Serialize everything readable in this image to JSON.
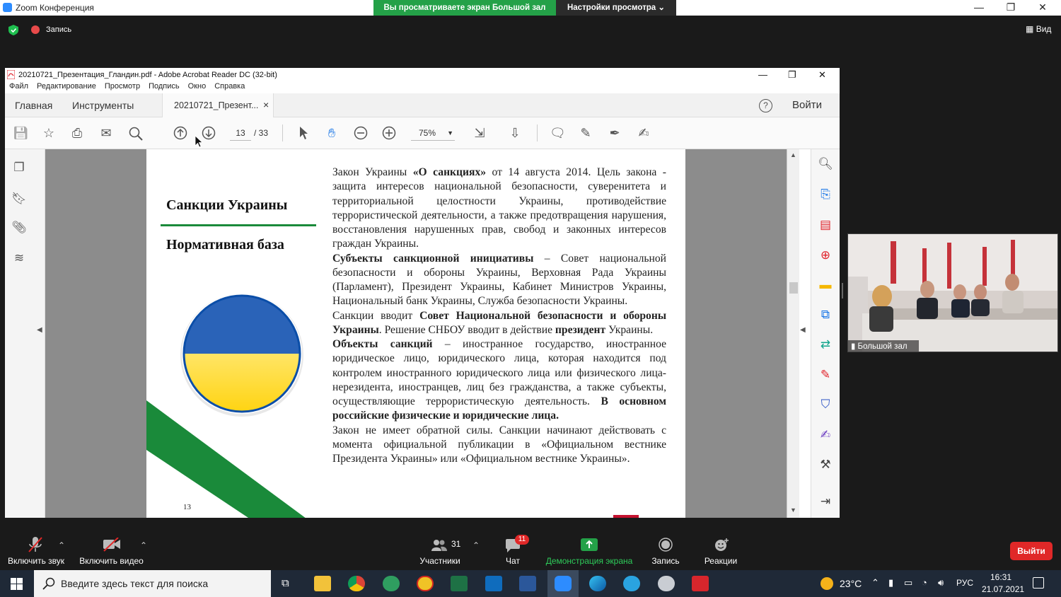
{
  "zoom": {
    "window_title": "Zoom Конференция",
    "share_banner": "Вы просматриваете экран Большой зал",
    "view_settings": "Настройки просмотра",
    "view_settings_caret": "⌄",
    "recording_label": "Запись",
    "view_label": "Вид",
    "minimize_glyph": "—",
    "maximize_glyph": "❐",
    "close_glyph": "✕"
  },
  "acrobat": {
    "title": "20210721_Презентация_Гландин.pdf - Adobe Acrobat Reader DC (32-bit)",
    "menu": [
      "Файл",
      "Редактирование",
      "Просмотр",
      "Подпись",
      "Окно",
      "Справка"
    ],
    "tabs": {
      "home": "Главная",
      "tools": "Инструменты",
      "doc": "20210721_Презент...",
      "close": "×"
    },
    "help": "?",
    "login": "Войти",
    "page_current": "13",
    "page_total": "/ 33",
    "zoom_level": "75%"
  },
  "slide": {
    "heading1": "Санкции Украины",
    "heading2": "Нормативная база",
    "page_number": "13",
    "paragraphs": [
      [
        {
          "t": "Закон Украины ",
          "b": false
        },
        {
          "t": "«О санкциях»",
          "b": true
        },
        {
          "t": " от 14 августа 2014. Цель закона - защита интересов национальной безопасности, суверенитета и территориальной целостности Украины, противодействие террористической деятельности, а также предотвращения нарушения, восстановления нарушенных прав, свобод и законных интересов граждан Украины.",
          "b": false
        }
      ],
      [
        {
          "t": "Субъекты санкционной инициативы",
          "b": true
        },
        {
          "t": " – Совет национальной безопасности и обороны Украины, Верховная Рада Украины (Парламент), Президент Украины, Кабинет Министров Украины, Национальный банк Украины, Служба безопасности Украины.",
          "b": false
        }
      ],
      [
        {
          "t": "Санкции вводит ",
          "b": false
        },
        {
          "t": "Совет Национальной безопасности и обороны Украины",
          "b": true
        },
        {
          "t": ". Решение СНБОУ вводит в действие ",
          "b": false
        },
        {
          "t": "президент",
          "b": true
        },
        {
          "t": " Украины.",
          "b": false
        }
      ],
      [
        {
          "t": "Объекты санкций",
          "b": true
        },
        {
          "t": " – иностранное государство, иностранное юридическое лицо, юридического лица, которая находится под контролем иностранного юридического лица или физического лица-нерезидента, иностранцев, лиц без гражданства, а также субъекты, осуществляющие террористическую деятельность. ",
          "b": false
        },
        {
          "t": "В основном российские физические и юридические лица.",
          "b": true
        }
      ],
      [
        {
          "t": "Закон не имеет обратной силы. Санкции начинают действовать с момента официальной публикации в «Официальном вестнике Президента Украины» или «Официальном вестнике Украины».",
          "b": false
        }
      ]
    ]
  },
  "video": {
    "participant_name": "Большой зал"
  },
  "controls": {
    "unmute": "Включить звук",
    "start_video": "Включить видео",
    "participants": "Участники",
    "participants_count": "31",
    "chat": "Чат",
    "chat_badge": "11",
    "share_screen": "Демонстрация экрана",
    "record": "Запись",
    "reactions": "Реакции",
    "leave": "Выйти",
    "caret": "⌃"
  },
  "taskbar": {
    "search_placeholder": "Введите здесь текст для поиска",
    "temperature": "23°C",
    "language": "РУС",
    "time": "16:31",
    "date": "21.07.2021"
  },
  "colors": {
    "ukraine_blue": "#0b5cc5",
    "ukraine_yellow": "#ffd500",
    "green_accent": "#1a8a3a",
    "zoom_green": "#24a148",
    "leave_red": "#e02828",
    "acrobat_red": "#e0232b",
    "acrobat_blue_icon": "#1473e6"
  }
}
